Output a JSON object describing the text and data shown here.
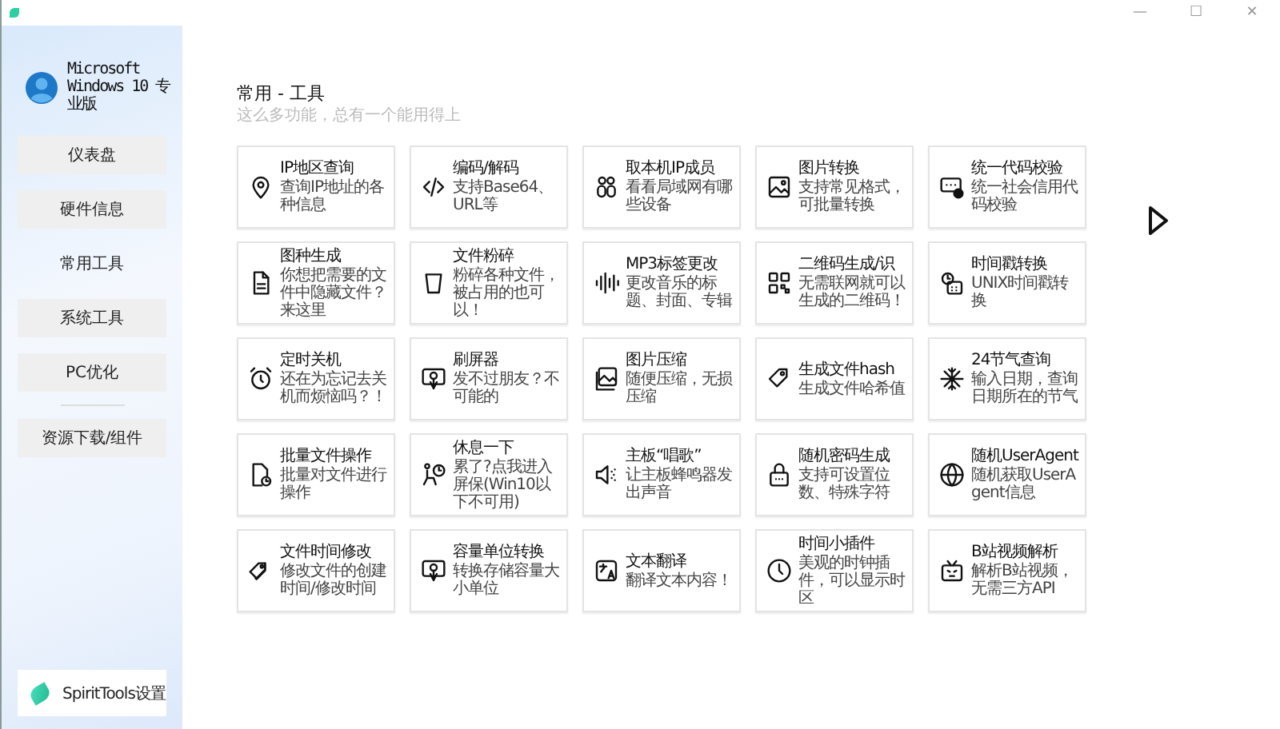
{
  "window": {
    "controls": [
      "—",
      "☐",
      "✕"
    ]
  },
  "sidebar": {
    "account": "Microsoft Windows 10 专业版",
    "items": [
      {
        "label": "仪表盘",
        "selected": false
      },
      {
        "label": "硬件信息",
        "selected": false
      },
      {
        "label": "常用工具",
        "selected": true
      },
      {
        "label": "系统工具",
        "selected": false
      },
      {
        "label": "PC优化",
        "selected": false
      },
      {
        "label": "资源下载/组件",
        "selected": false
      }
    ],
    "settings": "SpiritTools设置"
  },
  "page": {
    "title": "常用 - 工具",
    "subtitle": "这么多功能，总有一个能用得上"
  },
  "tools": [
    {
      "title": "IP地区查询",
      "description": "查询IP地址的各种信息"
    },
    {
      "title": "编码/解码",
      "description": "支持Base64、URL等"
    },
    {
      "title": "取本机IP成员",
      "description": "看看局域网有哪些设备"
    },
    {
      "title": "图片转换",
      "description": "支持常见格式，可批量转换"
    },
    {
      "title": "统一代码校验",
      "description": "统一社会信用代码校验"
    },
    {
      "title": "图种生成",
      "description": "你想把需要的文件中隐藏文件？来这里"
    },
    {
      "title": "文件粉碎",
      "description": "粉碎各种文件，被占用的也可以！"
    },
    {
      "title": "MP3标签更改",
      "description": "更改音乐的标题、封面、专辑"
    },
    {
      "title": "二维码生成/识",
      "description": "无需联网就可以生成的二维码！"
    },
    {
      "title": "时间戳转换",
      "description": "UNIX时间戳转换"
    },
    {
      "title": "定时关机",
      "description": "还在为忘记去关机而烦恼吗？！"
    },
    {
      "title": "刷屏器",
      "description": "发不过朋友？不可能的"
    },
    {
      "title": "图片压缩",
      "description": "随便压缩，无损压缩"
    },
    {
      "title": "生成文件hash",
      "description": "生成文件哈希值"
    },
    {
      "title": "24节气查询",
      "description": "输入日期，查询日期所在的节气"
    },
    {
      "title": "批量文件操作",
      "description": "批量对文件进行操作"
    },
    {
      "title": "休息一下",
      "description": "累了?点我进入屏保(Win10以下不可用)"
    },
    {
      "title": "主板“唱歌”",
      "description": "让主板蜂鸣器发出声音"
    },
    {
      "title": "随机密码生成",
      "description": "支持可设置位数、特殊字符"
    },
    {
      "title": "随机UserAgent",
      "description": "随机获取UserAgent信息"
    },
    {
      "title": "文件时间修改",
      "description": "修改文件的创建时间/修改时间"
    },
    {
      "title": "容量单位转换",
      "description": "转换存储容量大小单位"
    },
    {
      "title": "文本翻译",
      "description": "翻译文本内容！"
    },
    {
      "title": "时间小插件",
      "description": "美观的时钟插件，可以显示时区"
    },
    {
      "title": "B站视频解析",
      "description": "解析B站视频，无需三方API"
    }
  ]
}
